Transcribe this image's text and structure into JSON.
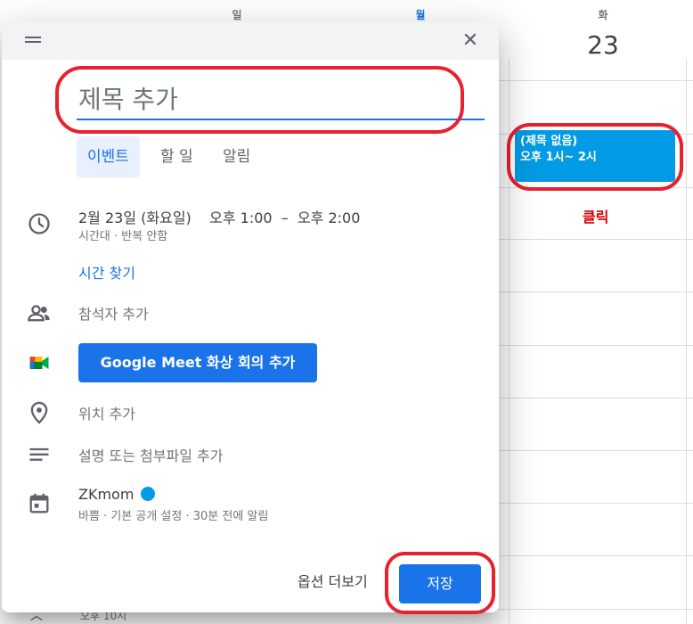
{
  "calendar": {
    "day_headers": [
      "일",
      "월",
      "화"
    ],
    "date_number": "23",
    "event": {
      "title": "(제목 없음)",
      "time": "오후 1시~ 2시"
    },
    "annotation": "클릭",
    "bottom_time": "오후 10시"
  },
  "dialog": {
    "title_placeholder": "제목 추가",
    "tabs": [
      "이벤트",
      "할 일",
      "알림"
    ],
    "datetime": "2월 23일 (화요일)    오후 1:00  –  오후 2:00",
    "datetime_sub": "시간대 · 반복 안함",
    "find_time": "시간 찾기",
    "add_guests": "참석자 추가",
    "meet_button": "Google Meet 화상 회의 추가",
    "add_location": "위치 추가",
    "add_description": "설명 또는 첨부파일 추가",
    "calendar_name": "ZKmom",
    "calendar_sub": "바쁨 · 기본 공개 설정 · 30분 전에 알림",
    "more_options": "옵션 더보기",
    "save": "저장"
  },
  "colors": {
    "accent": "#1a73e8",
    "event": "#039be5",
    "annotation": "#e8212d"
  },
  "icons": [
    "drag-handle-icon",
    "close-icon",
    "clock-icon",
    "people-icon",
    "google-meet-icon",
    "location-pin-icon",
    "notes-icon",
    "calendar-icon",
    "chevron-up-icon"
  ]
}
